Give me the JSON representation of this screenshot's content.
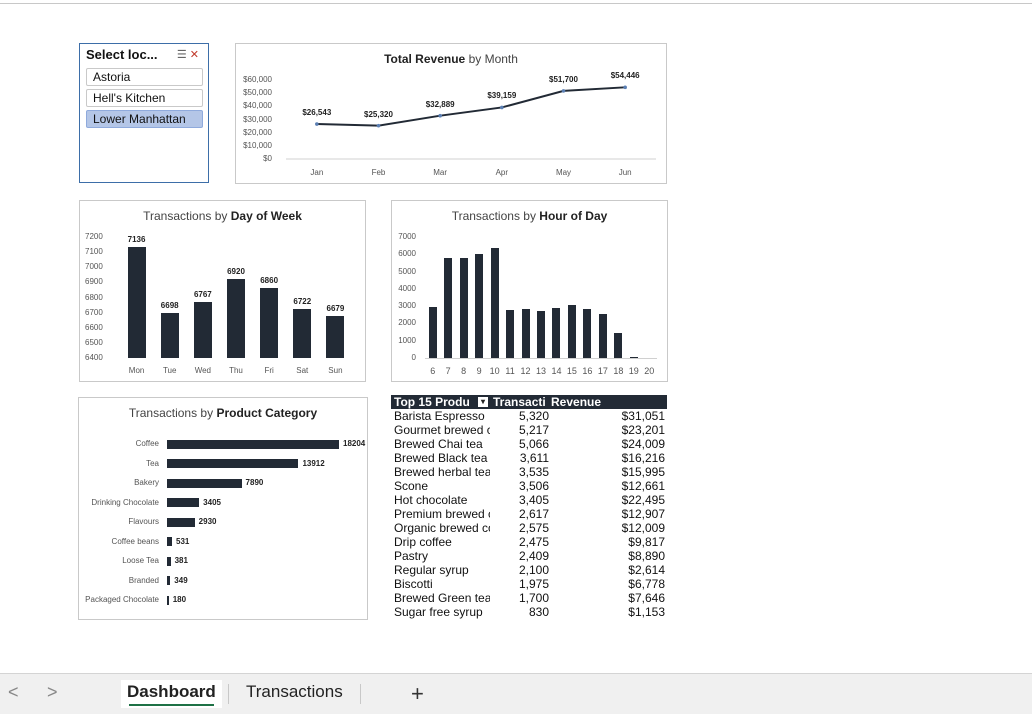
{
  "slicer": {
    "title": "Select loc...",
    "items": [
      {
        "label": "Astoria",
        "selected": false
      },
      {
        "label": "Hell's Kitchen",
        "selected": false
      },
      {
        "label": "Lower Manhattan",
        "selected": true
      }
    ]
  },
  "revenue_chart": {
    "title_plain": "Total Revenue",
    "title_bold": "by Month",
    "y_ticks": [
      "$60,000",
      "$50,000",
      "$40,000",
      "$30,000",
      "$20,000",
      "$10,000",
      "$0"
    ]
  },
  "dow_chart": {
    "title_plain": "Transactions by",
    "title_bold": "Day of Week",
    "y_ticks": [
      "7200",
      "7100",
      "7000",
      "6900",
      "6800",
      "6700",
      "6600",
      "6500",
      "6400"
    ]
  },
  "hour_chart": {
    "title_plain": "Transactions by",
    "title_bold": "Hour of Day",
    "y_ticks": [
      "7000",
      "6000",
      "5000",
      "4000",
      "3000",
      "2000",
      "1000",
      "0"
    ]
  },
  "category_chart": {
    "title_plain": "Transactions by",
    "title_bold": "Product Category"
  },
  "chart_data": [
    {
      "type": "line",
      "title": "Total Revenue by Month",
      "categories": [
        "Jan",
        "Feb",
        "Mar",
        "Apr",
        "May",
        "Jun"
      ],
      "values": [
        26543,
        25320,
        32889,
        39159,
        51700,
        54446
      ],
      "labels": [
        "$26,543",
        "$25,320",
        "$32,889",
        "$39,159",
        "$51,700",
        "$54,446"
      ],
      "ylim": [
        0,
        60000
      ],
      "color": "#222a35"
    },
    {
      "type": "bar",
      "title": "Transactions by Day of Week",
      "categories": [
        "Mon",
        "Tue",
        "Wed",
        "Thu",
        "Fri",
        "Sat",
        "Sun"
      ],
      "values": [
        7136,
        6698,
        6767,
        6920,
        6860,
        6722,
        6679
      ],
      "ylim": [
        6400,
        7200
      ]
    },
    {
      "type": "bar",
      "title": "Transactions by Hour of Day",
      "categories": [
        "6",
        "7",
        "8",
        "9",
        "10",
        "11",
        "12",
        "13",
        "14",
        "15",
        "16",
        "17",
        "18",
        "19",
        "20"
      ],
      "values": [
        2950,
        5800,
        5800,
        6000,
        6350,
        2800,
        2850,
        2700,
        2900,
        3050,
        2850,
        2550,
        1450,
        80,
        0
      ],
      "ylim": [
        0,
        7000
      ]
    },
    {
      "type": "bar",
      "orientation": "horizontal",
      "title": "Transactions by Product Category",
      "categories": [
        "Coffee",
        "Tea",
        "Bakery",
        "Drinking Chocolate",
        "Flavours",
        "Coffee beans",
        "Loose Tea",
        "Branded",
        "Packaged Chocolate"
      ],
      "values": [
        18204,
        13912,
        7890,
        3405,
        2930,
        531,
        381,
        349,
        180
      ]
    }
  ],
  "table": {
    "headers": [
      "Top 15 Produ",
      "Transacti",
      "Revenue"
    ],
    "rows": [
      [
        "Barista Espresso",
        "5,320",
        "$31,051"
      ],
      [
        "Gourmet brewed c",
        "5,217",
        "$23,201"
      ],
      [
        "Brewed Chai tea",
        "5,066",
        "$24,009"
      ],
      [
        "Brewed Black tea",
        "3,611",
        "$16,216"
      ],
      [
        "Brewed herbal tea",
        "3,535",
        "$15,995"
      ],
      [
        "Scone",
        "3,506",
        "$12,661"
      ],
      [
        "Hot chocolate",
        "3,405",
        "$22,495"
      ],
      [
        "Premium brewed c",
        "2,617",
        "$12,907"
      ],
      [
        "Organic brewed co",
        "2,575",
        "$12,009"
      ],
      [
        "Drip coffee",
        "2,475",
        "$9,817"
      ],
      [
        "Pastry",
        "2,409",
        "$8,890"
      ],
      [
        "Regular syrup",
        "2,100",
        "$2,614"
      ],
      [
        "Biscotti",
        "1,975",
        "$6,778"
      ],
      [
        "Brewed Green tea",
        "1,700",
        "$7,646"
      ],
      [
        "Sugar free syrup",
        "830",
        "$1,153"
      ]
    ]
  },
  "tabs": {
    "items": [
      "Dashboard",
      "Transactions"
    ],
    "active": "Dashboard",
    "add_symbol": "+",
    "prev_symbol": "<",
    "next_symbol": ">"
  },
  "colors": {
    "bar": "#222a35",
    "accent_tab": "#1e7145",
    "slicer_selected": "#b4c6e7"
  }
}
